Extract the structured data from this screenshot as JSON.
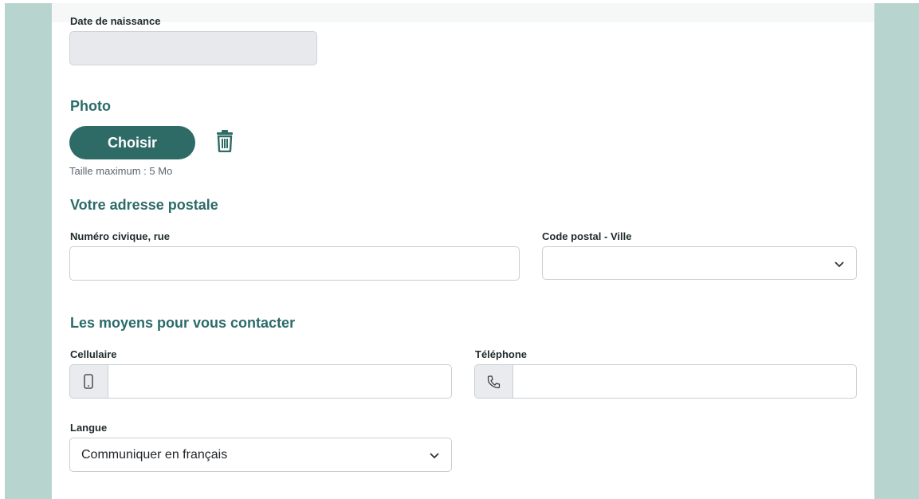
{
  "identity": {
    "birthdate_label": "Date de naissance",
    "birthdate_value": ""
  },
  "photo": {
    "title": "Photo",
    "choose_button": "Choisir",
    "delete_icon": "trash-icon",
    "size_hint": "Taille maximum : 5 Mo"
  },
  "address": {
    "title": "Votre adresse postale",
    "street_label": "Numéro civique, rue",
    "street_value": "",
    "postal_label": "Code postal - Ville",
    "postal_value": ""
  },
  "contact": {
    "title": "Les moyens pour vous contacter",
    "mobile_label": "Cellulaire",
    "mobile_icon": "mobile-phone-icon",
    "mobile_value": "",
    "phone_label": "Téléphone",
    "phone_icon": "telephone-icon",
    "phone_value": ""
  },
  "language": {
    "label": "Langue",
    "selected": "Communiquer en français"
  },
  "colors": {
    "accent": "#2e6b66",
    "section_title": "#2b6b6a",
    "side_panel": "#b7d4cf"
  }
}
